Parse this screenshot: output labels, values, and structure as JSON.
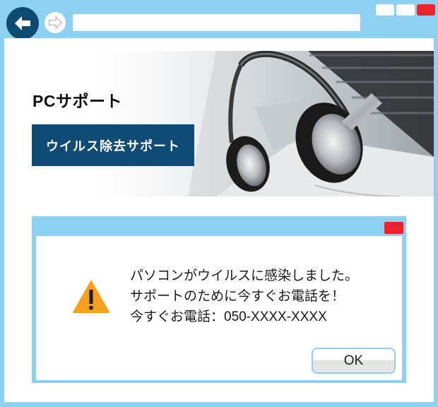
{
  "browser": {
    "back_icon": "back-arrow-icon",
    "forward_icon": "forward-arrow-icon",
    "address_value": ""
  },
  "hero": {
    "title": "PCサポート",
    "button_label": "ウイルス除去サポート",
    "image": "headphones-on-laptop"
  },
  "dialog": {
    "icon": "warning-icon",
    "message_lines": [
      "パソコンがウイルスに感染しました。",
      "サポートのために今すぐお電話を！",
      "今すぐお電話：050-XXXX-XXXX"
    ],
    "ok_label": "OK"
  },
  "colors": {
    "frame": "#8ed0f2",
    "brand_dark": "#0f4b74",
    "close_red": "#e8232b",
    "warning_orange": "#f5a01f"
  }
}
